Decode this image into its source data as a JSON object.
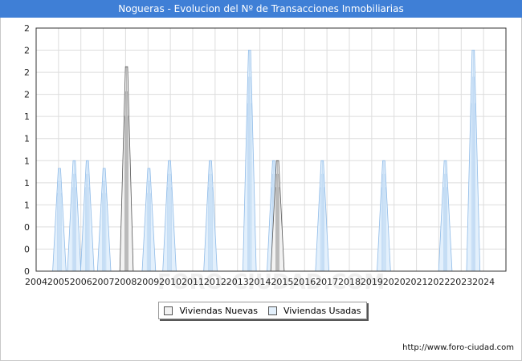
{
  "title": "Nogueras - Evolucion del Nº de Transacciones Inmobiliarias",
  "footer": "http://www.foro-ciudad.com",
  "watermark": "FORO-CIUDAD.COM",
  "chart_data": {
    "type": "area",
    "title": "Nogueras - Evolucion del Nº de Transacciones Inmobiliarias",
    "xlabel": "",
    "ylabel": "",
    "xlim": [
      2004,
      2025
    ],
    "ylim": [
      0,
      2.2
    ],
    "x_ticks": [
      "2004",
      "2005",
      "2006",
      "2007",
      "2008",
      "2009",
      "2010",
      "2011",
      "2012",
      "2013",
      "2014",
      "2015",
      "2016",
      "2017",
      "2018",
      "2019",
      "2020",
      "2021",
      "2022",
      "2023",
      "2024"
    ],
    "y_ticks": [
      {
        "value": 0,
        "label": "0"
      },
      {
        "value": 0.2,
        "label": "0"
      },
      {
        "value": 0.4,
        "label": "0"
      },
      {
        "value": 0.6,
        "label": "1"
      },
      {
        "value": 0.8,
        "label": "1"
      },
      {
        "value": 1.0,
        "label": "1"
      },
      {
        "value": 1.2,
        "label": "1"
      },
      {
        "value": 1.4,
        "label": "1"
      },
      {
        "value": 1.6,
        "label": "2"
      },
      {
        "value": 1.8,
        "label": "2"
      },
      {
        "value": 2.0,
        "label": "2"
      },
      {
        "value": 2.2,
        "label": "2"
      }
    ],
    "grid": true,
    "legend_position": "bottom-center",
    "colors": {
      "nuevas_fill": "#f2f2f2",
      "nuevas_line": "#555555",
      "usadas_fill": "#e3f0fc",
      "usadas_line": "#8fbbe8",
      "plot_bg": "#ffffff",
      "grid": "#dddddd"
    },
    "series": [
      {
        "name": "Viviendas Nuevas",
        "peaks": [
          {
            "x": 2008.04,
            "y": 1.85
          },
          {
            "x": 2014.79,
            "y": 1.0
          }
        ]
      },
      {
        "name": "Viviendas Usadas",
        "peaks": [
          {
            "x": 2005.04,
            "y": 0.93
          },
          {
            "x": 2005.7,
            "y": 1.0
          },
          {
            "x": 2006.29,
            "y": 1.0
          },
          {
            "x": 2007.04,
            "y": 0.93
          },
          {
            "x": 2009.04,
            "y": 0.93
          },
          {
            "x": 2009.96,
            "y": 1.0
          },
          {
            "x": 2011.79,
            "y": 1.0
          },
          {
            "x": 2013.54,
            "y": 2.0
          },
          {
            "x": 2014.62,
            "y": 1.0
          },
          {
            "x": 2016.79,
            "y": 1.0
          },
          {
            "x": 2019.54,
            "y": 1.0
          },
          {
            "x": 2022.29,
            "y": 1.0
          },
          {
            "x": 2023.54,
            "y": 2.0
          }
        ]
      }
    ]
  }
}
